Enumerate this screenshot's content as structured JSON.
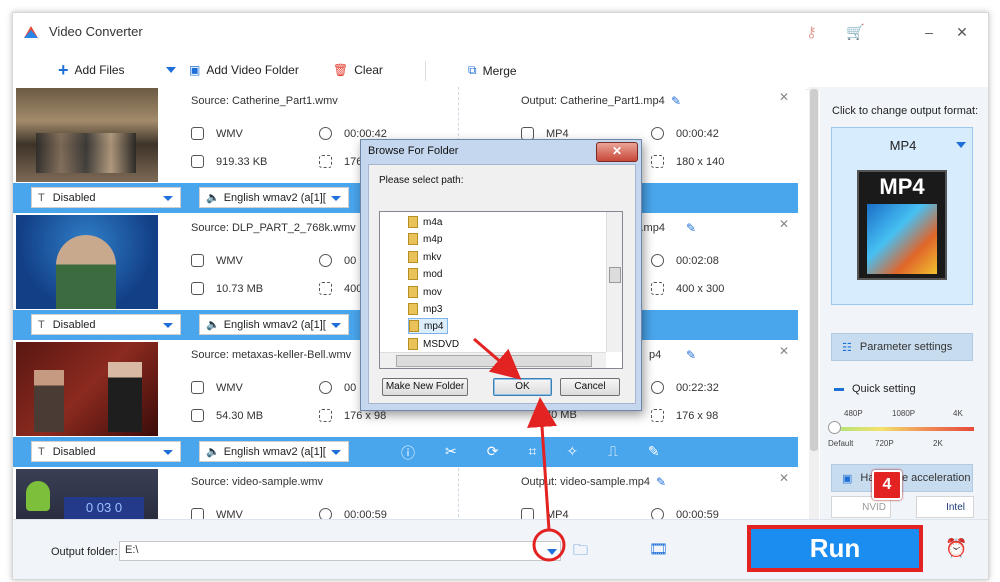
{
  "app": {
    "title": "Video Converter",
    "icons": [
      "key-icon",
      "cart-icon"
    ]
  },
  "window": {
    "minimize": "–",
    "close": "✕"
  },
  "toolbar": {
    "add_files": "Add Files",
    "add_video_folder": "Add Video Folder",
    "clear": "Clear",
    "merge": "Merge"
  },
  "items": [
    {
      "source": "Source: Catherine_Part1.wmv",
      "output": "Output: Catherine_Part1.mp4",
      "src_format": "WMV",
      "src_duration": "00:00:42",
      "src_size": "919.33 KB",
      "src_res": "176 x 98",
      "out_format": "MP4",
      "out_duration": "00:00:42",
      "out_size": "",
      "out_res": "180 x 140",
      "subtitle": "Disabled",
      "audio": "English wmav2 (a[1]["
    },
    {
      "source": "Source: DLP_PART_2_768k.wmv",
      "output": "k.mp4",
      "src_format": "WMV",
      "src_duration": "00",
      "src_size": "10.73 MB",
      "src_res": "400",
      "out_format": "",
      "out_duration": "00:02:08",
      "out_size": "",
      "out_res": "400 x 300",
      "subtitle": "Disabled",
      "audio": "English wmav2 (a[1]["
    },
    {
      "source": "Source: metaxas-keller-Bell.wmv",
      "output": "p4",
      "src_format": "WMV",
      "src_duration": "00",
      "src_size": "54.30 MB",
      "src_res": "176 x 98",
      "out_format": "",
      "out_duration": "00:22:32",
      "out_size": "30 MB",
      "out_res": "176 x 98",
      "subtitle": "Disabled",
      "audio": "English wmav2 (a[1]["
    },
    {
      "source": "Source: video-sample.wmv",
      "output": "Output: video-sample.mp4",
      "src_format": "WMV",
      "src_duration": "00:00:59",
      "src_size": "",
      "src_res": "",
      "out_format": "MP4",
      "out_duration": "00:00:59",
      "out_size": "",
      "out_res": "",
      "subtitle": "",
      "audio": ""
    }
  ],
  "right_panel": {
    "change_label": "Click to change output format:",
    "format": "MP4",
    "format_icon_text": "MP4",
    "parameter_settings": "Parameter settings",
    "quick_setting": "Quick setting",
    "slider_top": [
      "480P",
      "1080P",
      "4K"
    ],
    "slider_bottom": [
      "Default",
      "720P",
      "2K"
    ],
    "slider_level": 0,
    "hardware_acceleration": "Hardware acceleration",
    "nvidia": "NVID",
    "intel": "Intel"
  },
  "bottom": {
    "output_folder_label": "Output folder:",
    "output_folder_value": "E:\\",
    "run": "Run"
  },
  "badge": "4",
  "dialog": {
    "title": "Browse For Folder",
    "close": "✕",
    "prompt": "Please select path:",
    "folders": [
      "m4a",
      "m4p",
      "mkv",
      "mod",
      "mov",
      "mp3",
      "mp4",
      "MSDVD"
    ],
    "selected": "mp4",
    "make_new_folder": "Make New Folder",
    "ok": "OK",
    "cancel": "Cancel"
  },
  "colors": {
    "accent": "#1c8df0",
    "bar": "#49a5ec",
    "annotation": "#e32222"
  }
}
